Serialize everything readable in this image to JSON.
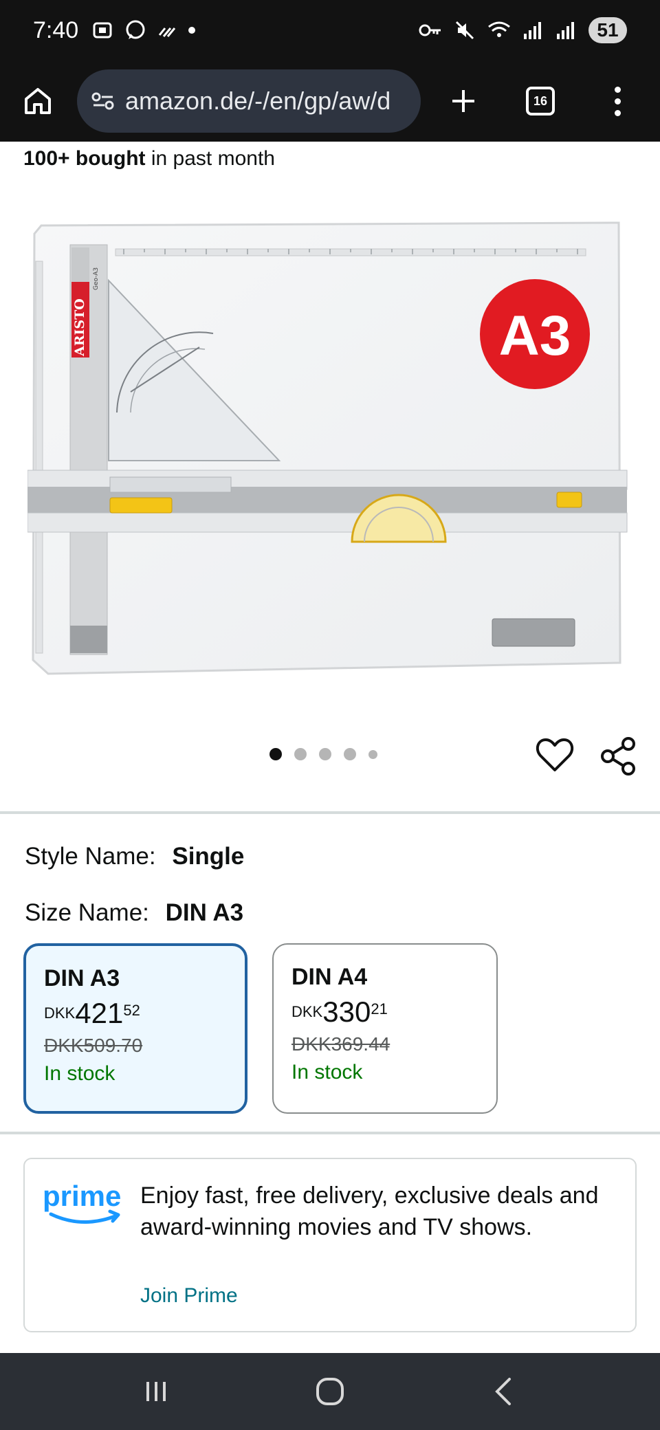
{
  "status_bar": {
    "time": "7:40",
    "battery": "51"
  },
  "browser": {
    "url": "amazon.de/-/en/gp/aw/d",
    "tab_count": "16"
  },
  "product": {
    "bought_count": "100+ bought",
    "bought_suffix": "in past month",
    "image_alt": "Aristo Geo-A3 drawing board",
    "image_badge": "A3",
    "image_brand": "ARISTO",
    "image_model": "Geo-A3"
  },
  "carousel": {
    "total": 5,
    "active": 0
  },
  "style": {
    "label": "Style Name:",
    "value": "Single"
  },
  "size": {
    "label": "Size Name:",
    "value": "DIN A3",
    "options": [
      {
        "title": "DIN A3",
        "currency": "DKK",
        "whole": "421",
        "fraction": "52",
        "old_price": "DKK509.70",
        "stock": "In stock"
      },
      {
        "title": "DIN A4",
        "currency": "DKK",
        "whole": "330",
        "fraction": "21",
        "old_price": "DKK369.44",
        "stock": "In stock"
      }
    ]
  },
  "prime": {
    "logo_text": "prime",
    "message": "Enjoy fast, free delivery, exclusive deals and award-winning movies and TV shows.",
    "cta": "Join Prime"
  },
  "colors": {
    "accent": "#2162a1",
    "stock_green": "#007600",
    "link": "#007185",
    "prime_blue": "#1a98ff"
  }
}
